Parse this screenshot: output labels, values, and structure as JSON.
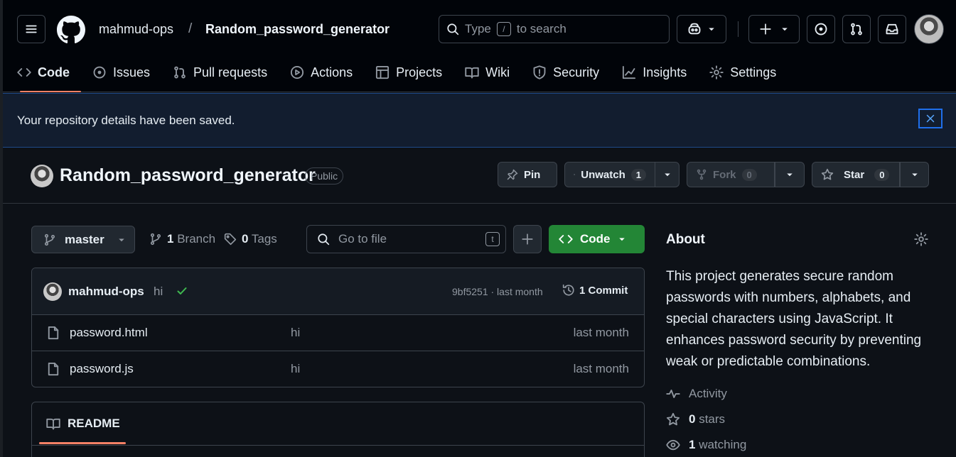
{
  "header": {
    "owner": "mahmud-ops",
    "separator": "/",
    "repo": "Random_password_generator",
    "search": {
      "prefix": "Type",
      "key": "/",
      "suffix": "to search"
    }
  },
  "tabs": [
    {
      "label": "Code",
      "icon": "code-icon"
    },
    {
      "label": "Issues",
      "icon": "issue-icon"
    },
    {
      "label": "Pull requests",
      "icon": "pull-request-icon"
    },
    {
      "label": "Actions",
      "icon": "play-icon"
    },
    {
      "label": "Projects",
      "icon": "table-icon"
    },
    {
      "label": "Wiki",
      "icon": "book-icon"
    },
    {
      "label": "Security",
      "icon": "shield-icon"
    },
    {
      "label": "Insights",
      "icon": "graph-icon"
    },
    {
      "label": "Settings",
      "icon": "gear-icon"
    }
  ],
  "flash": {
    "message": "Your repository details have been saved."
  },
  "repo": {
    "name": "Random_password_generator",
    "visibility": "Public",
    "pin_label": "Pin",
    "watch_label": "Unwatch",
    "watch_count": "1",
    "fork_label": "Fork",
    "fork_count": "0",
    "star_label": "Star",
    "star_count": "0"
  },
  "branchbar": {
    "branch": "master",
    "branches_count": "1",
    "branches_label": "Branch",
    "tags_count": "0",
    "tags_label": "Tags",
    "goto_placeholder": "Go to file",
    "goto_key": "t",
    "code_label": "Code"
  },
  "commit": {
    "user": "mahmud-ops",
    "message": "hi",
    "meta": "9bf5251 · last month",
    "count_label": "1 Commit"
  },
  "files": [
    {
      "name": "password.html",
      "message": "hi",
      "date": "last month"
    },
    {
      "name": "password.js",
      "message": "hi",
      "date": "last month"
    }
  ],
  "readme": {
    "label": "README"
  },
  "about": {
    "title": "About",
    "description": "This project generates secure random passwords with numbers, alphabets, and special characters using JavaScript. It enhances password security by preventing weak or predictable combinations.",
    "activity": "Activity",
    "stars_count": "0",
    "stars_label": "stars",
    "watching_count": "1",
    "watching_label": "watching"
  },
  "colors": {
    "accent_green": "#238636",
    "tab_underline": "#f78166",
    "flash_border": "#1f6feb"
  }
}
